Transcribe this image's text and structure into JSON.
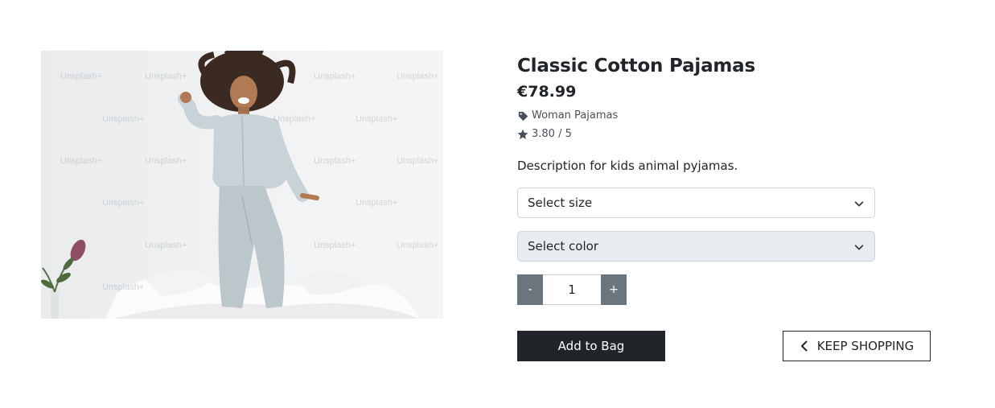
{
  "product": {
    "title": "Classic Cotton Pajamas",
    "price": "€78.99",
    "category": "Woman Pajamas",
    "rating": "3.80 / 5",
    "description": "Description for kids animal pyjamas.",
    "image": {
      "subject": "woman in light grey pajamas jumping on a bed",
      "watermark_text": "Unsplash+"
    }
  },
  "options": {
    "size_placeholder": "Select size",
    "color_placeholder": "Select color"
  },
  "quantity": {
    "decrement_label": "-",
    "value": "1",
    "increment_label": "+"
  },
  "actions": {
    "add_to_bag_label": "Add to Bag",
    "keep_shopping_label": "KEEP SHOPPING"
  },
  "icons": {
    "category": "tag-icon",
    "rating": "star-icon",
    "select": "chevron-down-icon",
    "back": "chevron-left-icon"
  },
  "colors": {
    "primary_dark": "#212529",
    "secondary": "#6c757d",
    "select_disabled_bg": "#e9ecef",
    "border": "#ced4da"
  }
}
